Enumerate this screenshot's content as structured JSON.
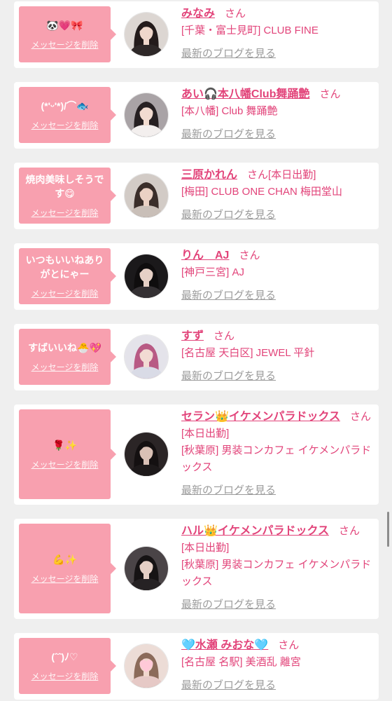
{
  "theme": {
    "page_bg": "#efefef",
    "card_bg": "#ffffff",
    "bubble_bg": "#f8a0af",
    "bubble_text": "#ffffff",
    "accent": "#e2447a",
    "link_muted": "#9b9b9b",
    "scrollbar": "#8c8c8c"
  },
  "messages": [
    {
      "message": "🐼💗🎀",
      "delete_label": "メッセージを削除",
      "name": "みなみ",
      "honorific": "さん",
      "store": "[千葉・富士見町] CLUB FINE",
      "blog_label": "最新のブログを見る"
    },
    {
      "message": "(*'ᵕ'*)/⌒🐟",
      "delete_label": "メッセージを削除",
      "name": "あい🎧本八幡Club舞踊艶",
      "honorific": "さん",
      "store": "[本八幡] Club 舞踊艶",
      "blog_label": "最新のブログを見る"
    },
    {
      "message": "焼肉美味しそうです😋",
      "delete_label": "メッセージを削除",
      "name": "三原かれん",
      "honorific": "さん",
      "status": "[本日出勤]",
      "store": "[梅田] CLUB ONE CHAN 梅田堂山",
      "blog_label": "最新のブログを見る"
    },
    {
      "message": "いつもいいねありがとにゃー",
      "delete_label": "メッセージを削除",
      "name": "りん　AJ",
      "honorific": "さん",
      "store": "[神戸三宮] AJ",
      "blog_label": "最新のブログを見る"
    },
    {
      "message": "すばいいね🐣💖",
      "delete_label": "メッセージを削除",
      "name": "すず",
      "honorific": "さん",
      "store": "[名古屋 天白区] JEWEL 平針",
      "blog_label": "最新のブログを見る"
    },
    {
      "message": "🌹✨",
      "delete_label": "メッセージを削除",
      "name": "セラン👑イケメンパラドックス",
      "honorific": "さん",
      "status": "[本日出勤]",
      "store": "[秋葉原] 男装コンカフェ イケメンパラドックス",
      "blog_label": "最新のブログを見る"
    },
    {
      "message": "💪✨",
      "delete_label": "メッセージを削除",
      "name": "ハル👑イケメンパラドックス",
      "honorific": "さん",
      "status": "[本日出勤]",
      "store": "[秋葉原] 男装コンカフェ イケメンパラドックス",
      "blog_label": "最新のブログを見る"
    },
    {
      "message": "(ˆˆ)ﾉ♡",
      "delete_label": "メッセージを削除",
      "name": "🩵水瀬 みおな🩵",
      "honorific": "さん",
      "store": "[名古屋 名駅] 美酒乱 離宮",
      "blog_label": "最新のブログを見る"
    }
  ]
}
